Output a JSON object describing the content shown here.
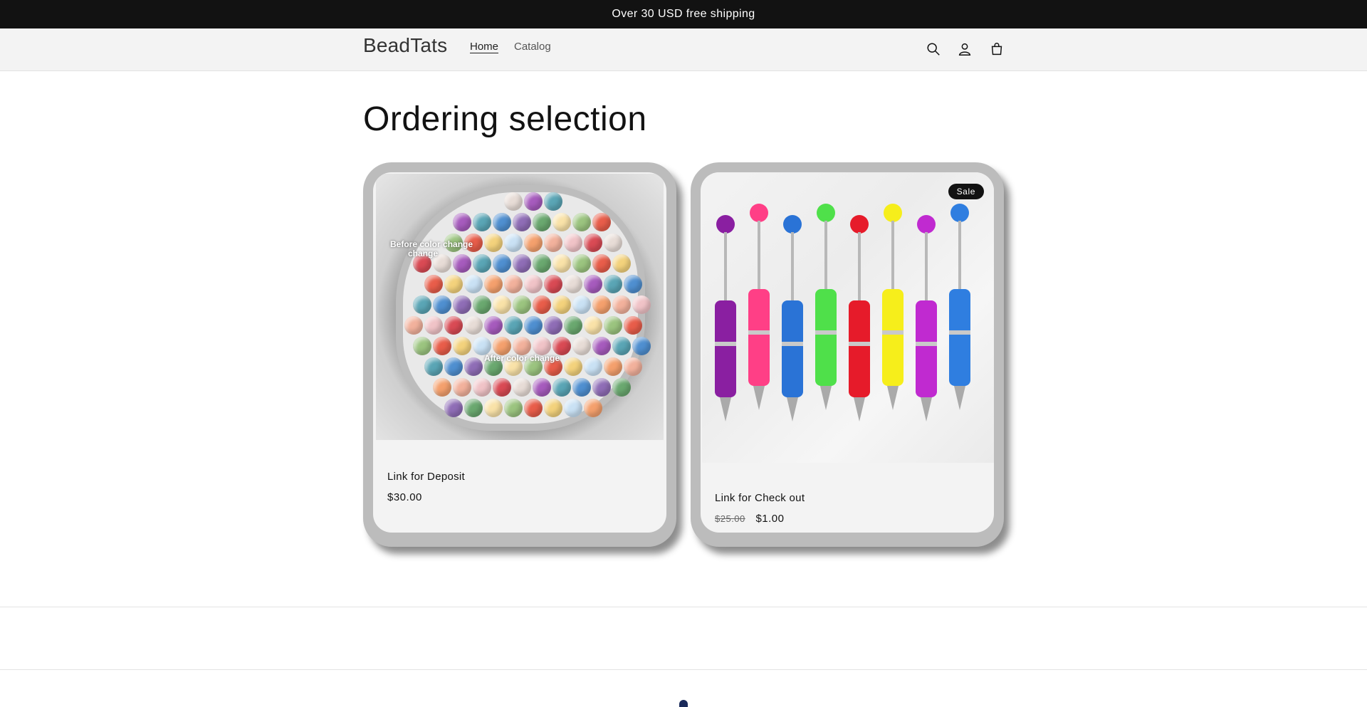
{
  "announcement": {
    "text": "Over 30 USD free shipping"
  },
  "header": {
    "logo": "BeadTats",
    "nav": [
      {
        "label": "Home",
        "active": true
      },
      {
        "label": "Catalog",
        "active": false
      }
    ],
    "icons": [
      "search-icon",
      "account-icon",
      "cart-icon"
    ]
  },
  "collection": {
    "title": "Ordering selection",
    "products": [
      {
        "title": "Link for Deposit",
        "price": "$30.00",
        "image_caption_top": "Before color change",
        "image_caption_top_2": "change",
        "image_caption_bottom": "After color change"
      },
      {
        "title": "Link for Check out",
        "badge": "Sale",
        "compare_price": "$25.00",
        "price": "$1.00"
      }
    ]
  },
  "colors": {
    "announcement_bg": "#121212",
    "header_bg": "#f3f3f3",
    "card_frame": "#bcbcbc",
    "card_bg": "#f3f3f3",
    "badge_bg": "#121212"
  }
}
